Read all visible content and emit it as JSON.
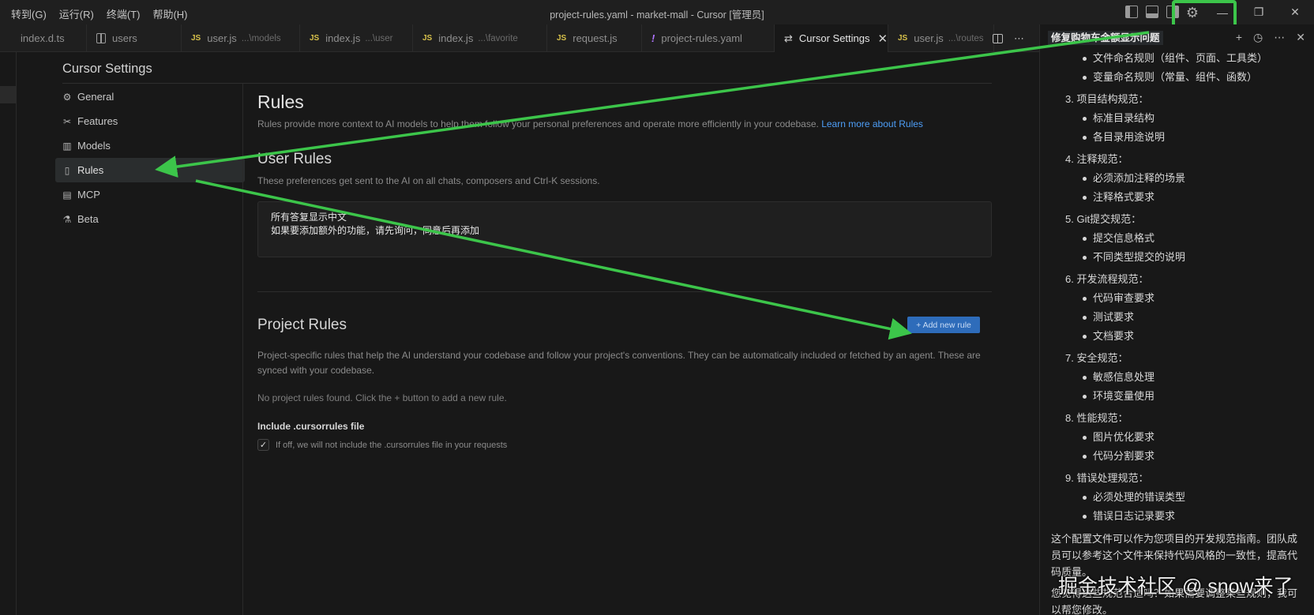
{
  "menu": [
    "转到(G)",
    "运行(R)",
    "终端(T)",
    "帮助(H)"
  ],
  "window_title": "project-rules.yaml - market-mall - Cursor [管理员]",
  "tabs": [
    {
      "label": "index.d.ts",
      "hint": "",
      "icon": "ts"
    },
    {
      "label": "users",
      "hint": "",
      "icon": "book-icon"
    },
    {
      "label": "user.js",
      "hint": "...\\models",
      "icon": "JS"
    },
    {
      "label": "index.js",
      "hint": "...\\user",
      "icon": "JS"
    },
    {
      "label": "index.js",
      "hint": "...\\favorite",
      "icon": "JS"
    },
    {
      "label": "request.js",
      "hint": "",
      "icon": "JS"
    },
    {
      "label": "project-rules.yaml",
      "hint": "",
      "icon": "!"
    },
    {
      "label": "Cursor Settings",
      "hint": "",
      "icon": "sliders-icon"
    },
    {
      "label": "user.js",
      "hint": "...\\routes",
      "icon": "JS"
    }
  ],
  "settings": {
    "title": "Cursor Settings",
    "nav": [
      {
        "label": "General",
        "icon": "gear-icon"
      },
      {
        "label": "Features",
        "icon": "tools-icon"
      },
      {
        "label": "Models",
        "icon": "bar-chart-icon"
      },
      {
        "label": "Rules",
        "icon": "file-icon"
      },
      {
        "label": "MCP",
        "icon": "server-icon"
      },
      {
        "label": "Beta",
        "icon": "flask-icon"
      }
    ],
    "rules_heading": "Rules",
    "rules_desc": "Rules provide more context to AI models to help them follow your personal preferences and operate more efficiently in your codebase.",
    "rules_link": "Learn more about Rules",
    "user_rules_heading": "User Rules",
    "user_rules_desc": "These preferences get sent to the AI on all chats, composers and Ctrl-K sessions.",
    "user_rules_lines": [
      "所有答复显示中文",
      "如果要添加额外的功能，请先询问，同意后再添加"
    ],
    "project_rules_heading": "Project Rules",
    "add_rule_label": "+ Add new rule",
    "project_rules_desc": "Project-specific rules that help the AI understand your codebase and follow your project's conventions. They can be automatically included or fetched by an agent. These are synced with your codebase.",
    "no_rules": "No project rules found. Click the + button to add a new rule.",
    "include_title": "Include .cursorrules file",
    "include_desc": "If off, we will not include the .cursorrules file in your requests",
    "include_checked": true
  },
  "chat": {
    "tab_title": "修复购物车金额显示问题",
    "items": [
      {
        "type": "bullet",
        "text": "文件命名规则（组件、页面、工具类）"
      },
      {
        "type": "bullet",
        "text": "变量命名规则（常量、组件、函数）"
      },
      {
        "type": "num",
        "text": "3. 项目结构规范："
      },
      {
        "type": "bullet",
        "text": "标准目录结构"
      },
      {
        "type": "bullet",
        "text": "各目录用途说明"
      },
      {
        "type": "num",
        "text": "4. 注释规范："
      },
      {
        "type": "bullet",
        "text": "必须添加注释的场景"
      },
      {
        "type": "bullet",
        "text": "注释格式要求"
      },
      {
        "type": "num",
        "text": "5. Git提交规范："
      },
      {
        "type": "bullet",
        "text": "提交信息格式"
      },
      {
        "type": "bullet",
        "text": "不同类型提交的说明"
      },
      {
        "type": "num",
        "text": "6. 开发流程规范："
      },
      {
        "type": "bullet",
        "text": "代码审查要求"
      },
      {
        "type": "bullet",
        "text": "测试要求"
      },
      {
        "type": "bullet",
        "text": "文档要求"
      },
      {
        "type": "num",
        "text": "7. 安全规范："
      },
      {
        "type": "bullet",
        "text": "敏感信息处理"
      },
      {
        "type": "bullet",
        "text": "环境变量使用"
      },
      {
        "type": "num",
        "text": "8. 性能规范："
      },
      {
        "type": "bullet",
        "text": "图片优化要求"
      },
      {
        "type": "bullet",
        "text": "代码分割要求"
      },
      {
        "type": "num",
        "text": "9. 错误处理规范："
      },
      {
        "type": "bullet",
        "text": "必须处理的错误类型"
      },
      {
        "type": "bullet",
        "text": "错误日志记录要求"
      }
    ],
    "summary": "这个配置文件可以作为您项目的开发规范指南。团队成员可以参考这个文件来保持代码风格的一致性，提高代码质量。",
    "question": "您觉得这些规范合适吗？如果需要调整某些规则，我可以帮您修改。"
  },
  "watermark": "掘金技术社区 @ snow来了",
  "colors": {
    "annotation": "#3cc54a",
    "accent": "#2e6cba",
    "link": "#4d9ef7"
  }
}
